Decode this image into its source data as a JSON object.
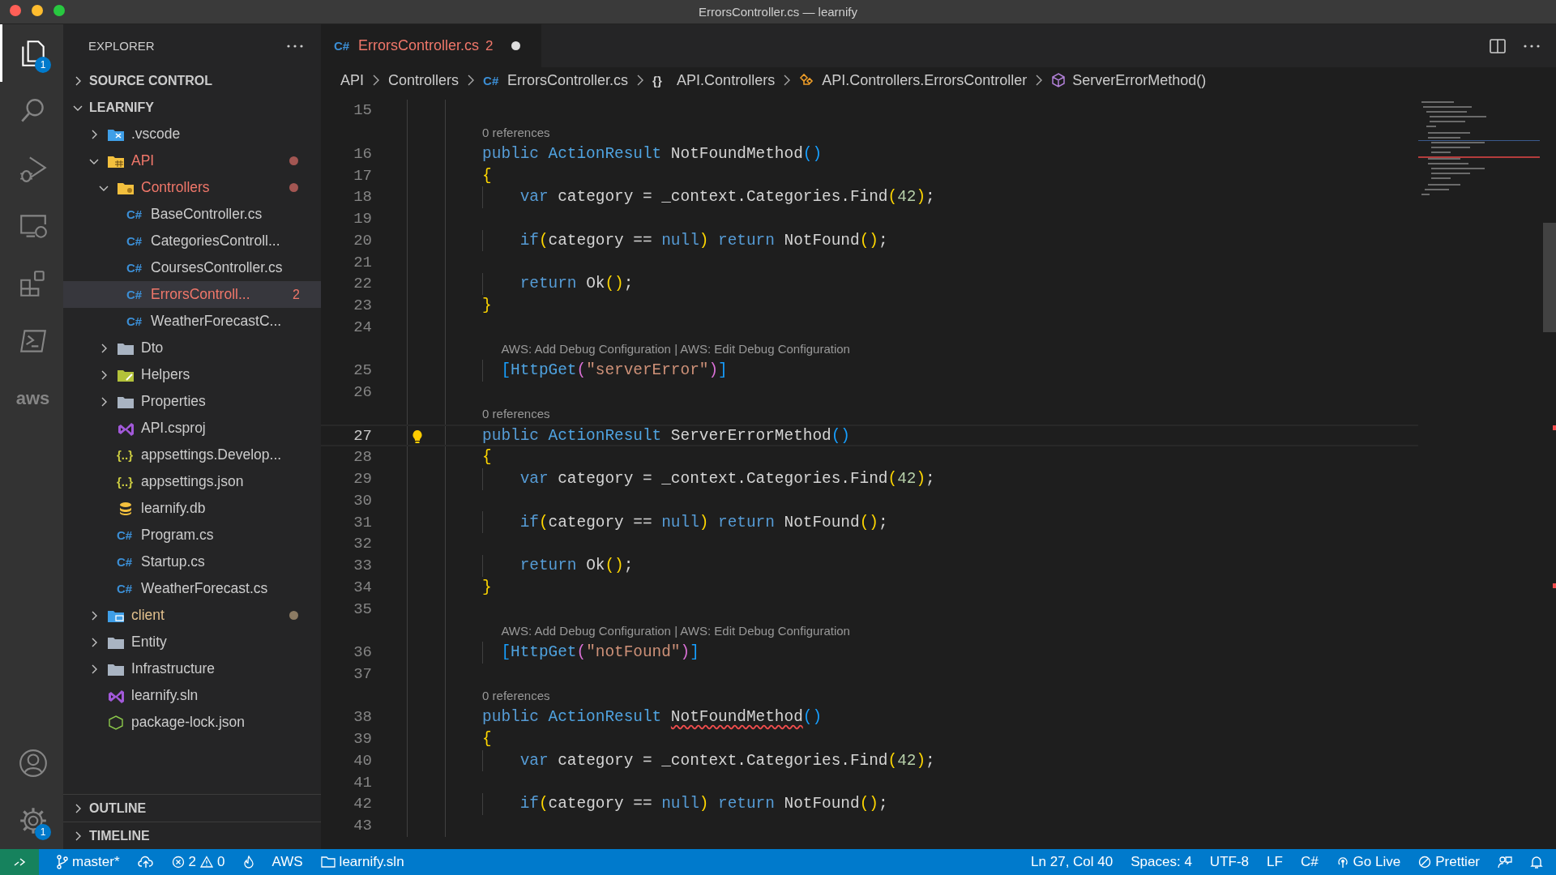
{
  "window": {
    "title": "ErrorsController.cs — learnify"
  },
  "activity_bar": {
    "top": [
      {
        "kind": "explorer",
        "selected": true,
        "badge": "1"
      },
      {
        "kind": "search",
        "selected": false
      },
      {
        "kind": "debug",
        "selected": false
      },
      {
        "kind": "remote",
        "selected": false
      },
      {
        "kind": "extensions",
        "selected": false
      },
      {
        "kind": "terminal",
        "selected": false
      },
      {
        "kind": "aws",
        "selected": false,
        "glyph": "aws"
      }
    ],
    "bottom": [
      {
        "kind": "account",
        "selected": false
      },
      {
        "kind": "settings",
        "selected": false,
        "badge": "1"
      }
    ]
  },
  "explorer": {
    "title": "EXPLORER",
    "sections": [
      {
        "label": "SOURCE CONTROL",
        "expanded": false
      },
      {
        "label": "LEARNIFY",
        "expanded": true,
        "tree": [
          {
            "label": ".vscode",
            "kind": "folder-vscode",
            "expanded": false,
            "has_errors": false,
            "modified": false,
            "selected": false
          },
          {
            "label": "API",
            "kind": "folder-api",
            "expanded": true,
            "has_errors": true,
            "modified": false,
            "selected": false,
            "children": [
              {
                "label": "Controllers",
                "kind": "folder-controllers",
                "expanded": true,
                "has_errors": true,
                "modified": false,
                "selected": false,
                "children": [
                  {
                    "label": "BaseController.cs",
                    "kind": "csharp",
                    "glyph": "C#",
                    "has_errors": false,
                    "modified": false,
                    "selected": false
                  },
                  {
                    "label": "CategoriesControll...",
                    "kind": "csharp",
                    "glyph": "C#",
                    "has_errors": false,
                    "modified": false,
                    "selected": false
                  },
                  {
                    "label": "CoursesController.cs",
                    "kind": "csharp",
                    "glyph": "C#",
                    "has_errors": false,
                    "modified": false,
                    "selected": false
                  },
                  {
                    "label": "ErrorsControll...",
                    "kind": "csharp",
                    "glyph": "C#",
                    "has_errors": true,
                    "modified": false,
                    "badge": "2",
                    "selected": true
                  },
                  {
                    "label": "WeatherForecastC...",
                    "kind": "csharp",
                    "glyph": "C#",
                    "has_errors": false,
                    "modified": false,
                    "selected": false
                  }
                ]
              },
              {
                "label": "Dto",
                "kind": "folder",
                "expanded": false,
                "has_errors": false,
                "modified": false,
                "selected": false
              },
              {
                "label": "Helpers",
                "kind": "folder-helpers",
                "expanded": false,
                "has_errors": false,
                "modified": false,
                "selected": false
              },
              {
                "label": "Properties",
                "kind": "folder",
                "expanded": false,
                "has_errors": false,
                "modified": false,
                "selected": false
              },
              {
                "label": "API.csproj",
                "kind": "vs",
                "has_errors": false,
                "modified": false,
                "selected": false
              },
              {
                "label": "appsettings.Develop...",
                "kind": "json",
                "glyph": "{..}",
                "has_errors": false,
                "modified": false,
                "selected": false
              },
              {
                "label": "appsettings.json",
                "kind": "json",
                "glyph": "{..}",
                "has_errors": false,
                "modified": false,
                "selected": false
              },
              {
                "label": "learnify.db",
                "kind": "db",
                "has_errors": false,
                "modified": false,
                "selected": false
              },
              {
                "label": "Program.cs",
                "kind": "csharp",
                "glyph": "C#",
                "has_errors": false,
                "modified": false,
                "selected": false
              },
              {
                "label": "Startup.cs",
                "kind": "csharp",
                "glyph": "C#",
                "has_errors": false,
                "modified": false,
                "selected": false
              },
              {
                "label": "WeatherForecast.cs",
                "kind": "csharp",
                "glyph": "C#",
                "has_errors": false,
                "modified": false,
                "selected": false
              }
            ]
          },
          {
            "label": "client",
            "kind": "folder-client",
            "expanded": false,
            "has_errors": false,
            "modified": true,
            "selected": false
          },
          {
            "label": "Entity",
            "kind": "folder",
            "expanded": false,
            "has_errors": false,
            "modified": false,
            "selected": false
          },
          {
            "label": "Infrastructure",
            "kind": "folder",
            "expanded": false,
            "has_errors": false,
            "modified": false,
            "selected": false
          },
          {
            "label": "learnify.sln",
            "kind": "vs",
            "has_errors": false,
            "modified": false,
            "selected": false
          },
          {
            "label": "package-lock.json",
            "kind": "node",
            "has_errors": false,
            "modified": false,
            "selected": false
          }
        ]
      },
      {
        "label": "OUTLINE",
        "expanded": false
      },
      {
        "label": "TIMELINE",
        "expanded": false
      }
    ]
  },
  "tabs": [
    {
      "label": "ErrorsController.cs",
      "kind": "csharp",
      "glyph": "C#",
      "problems": "2",
      "dirty": true,
      "selected": true
    }
  ],
  "breadcrumbs": [
    {
      "label": "API"
    },
    {
      "label": "Controllers"
    },
    {
      "label": "ErrorsController.cs",
      "kind": "csharp",
      "glyph": "C#"
    },
    {
      "label": "API.Controllers",
      "kind": "namespace",
      "glyph": "{}"
    },
    {
      "label": "API.Controllers.ErrorsController",
      "kind": "class"
    },
    {
      "label": "ServerErrorMethod()",
      "kind": "method"
    }
  ],
  "editor": {
    "lines": [
      {
        "kind": "code",
        "number": "15",
        "active": false
      },
      {
        "kind": "lens",
        "text": "0 references"
      },
      {
        "kind": "code",
        "number": "16",
        "active": false,
        "tokens": [
          {
            "text": "        public ",
            "kind": "kw"
          },
          {
            "text": "ActionResult ",
            "kind": "type"
          },
          {
            "text": "NotFoundMethod",
            "kind": "plain"
          },
          {
            "text": "()",
            "kind": "b3"
          }
        ]
      },
      {
        "kind": "code",
        "number": "17",
        "active": false,
        "tokens": [
          {
            "text": "        {",
            "kind": "b1"
          }
        ]
      },
      {
        "kind": "code",
        "number": "18",
        "active": false,
        "tokens": [
          {
            "text": "            var ",
            "kind": "kw"
          },
          {
            "text": "category = _context.Categories.Find",
            "kind": "plain"
          },
          {
            "text": "(",
            "kind": "b1"
          },
          {
            "text": "42",
            "kind": "num"
          },
          {
            "text": ")",
            "kind": "b1"
          },
          {
            "text": ";",
            "kind": "plain"
          }
        ]
      },
      {
        "kind": "code",
        "number": "19",
        "active": false
      },
      {
        "kind": "code",
        "number": "20",
        "active": false,
        "tokens": [
          {
            "text": "            if",
            "kind": "kw"
          },
          {
            "text": "(",
            "kind": "b1"
          },
          {
            "text": "category == ",
            "kind": "plain"
          },
          {
            "text": "null",
            "kind": "kw"
          },
          {
            "text": ") ",
            "kind": "b1"
          },
          {
            "text": "return ",
            "kind": "kw"
          },
          {
            "text": "NotFound",
            "kind": "plain"
          },
          {
            "text": "()",
            "kind": "b1"
          },
          {
            "text": ";",
            "kind": "plain"
          }
        ]
      },
      {
        "kind": "code",
        "number": "21",
        "active": false
      },
      {
        "kind": "code",
        "number": "22",
        "active": false,
        "tokens": [
          {
            "text": "            return ",
            "kind": "kw"
          },
          {
            "text": "Ok",
            "kind": "plain"
          },
          {
            "text": "()",
            "kind": "b1"
          },
          {
            "text": ";",
            "kind": "plain"
          }
        ]
      },
      {
        "kind": "code",
        "number": "23",
        "active": false,
        "tokens": [
          {
            "text": "        }",
            "kind": "b1"
          }
        ]
      },
      {
        "kind": "code",
        "number": "24",
        "active": false
      },
      {
        "kind": "lens",
        "text": "AWS: Add Debug Configuration | AWS: Edit Debug Configuration"
      },
      {
        "kind": "code",
        "number": "25",
        "active": false,
        "tokens": [
          {
            "text": "          [",
            "kind": "b3"
          },
          {
            "text": "HttpGet",
            "kind": "type"
          },
          {
            "text": "(",
            "kind": "b2"
          },
          {
            "text": "\"serverError\"",
            "kind": "str"
          },
          {
            "text": ")",
            "kind": "b2"
          },
          {
            "text": "]",
            "kind": "b3"
          }
        ]
      },
      {
        "kind": "code",
        "number": "26",
        "active": false
      },
      {
        "kind": "lens",
        "text": "0 references"
      },
      {
        "kind": "code",
        "number": "27",
        "active": true,
        "tokens": [
          {
            "text": "        public ",
            "kind": "kw"
          },
          {
            "text": "ActionResult ",
            "kind": "type"
          },
          {
            "text": "ServerErrorMethod",
            "kind": "plain"
          },
          {
            "text": "()",
            "kind": "b3"
          }
        ]
      },
      {
        "kind": "code",
        "number": "28",
        "active": false,
        "tokens": [
          {
            "text": "        {",
            "kind": "b1"
          }
        ]
      },
      {
        "kind": "code",
        "number": "29",
        "active": false,
        "tokens": [
          {
            "text": "            var ",
            "kind": "kw"
          },
          {
            "text": "category = _context.Categories.Find",
            "kind": "plain"
          },
          {
            "text": "(",
            "kind": "b1"
          },
          {
            "text": "42",
            "kind": "num"
          },
          {
            "text": ")",
            "kind": "b1"
          },
          {
            "text": ";",
            "kind": "plain"
          }
        ]
      },
      {
        "kind": "code",
        "number": "30",
        "active": false
      },
      {
        "kind": "code",
        "number": "31",
        "active": false,
        "tokens": [
          {
            "text": "            if",
            "kind": "kw"
          },
          {
            "text": "(",
            "kind": "b1"
          },
          {
            "text": "category == ",
            "kind": "plain"
          },
          {
            "text": "null",
            "kind": "kw"
          },
          {
            "text": ") ",
            "kind": "b1"
          },
          {
            "text": "return ",
            "kind": "kw"
          },
          {
            "text": "NotFound",
            "kind": "plain"
          },
          {
            "text": "()",
            "kind": "b1"
          },
          {
            "text": ";",
            "kind": "plain"
          }
        ]
      },
      {
        "kind": "code",
        "number": "32",
        "active": false
      },
      {
        "kind": "code",
        "number": "33",
        "active": false,
        "tokens": [
          {
            "text": "            return ",
            "kind": "kw"
          },
          {
            "text": "Ok",
            "kind": "plain"
          },
          {
            "text": "()",
            "kind": "b1"
          },
          {
            "text": ";",
            "kind": "plain"
          }
        ]
      },
      {
        "kind": "code",
        "number": "34",
        "active": false,
        "tokens": [
          {
            "text": "        }",
            "kind": "b1"
          }
        ]
      },
      {
        "kind": "code",
        "number": "35",
        "active": false
      },
      {
        "kind": "lens",
        "text": "AWS: Add Debug Configuration | AWS: Edit Debug Configuration"
      },
      {
        "kind": "code",
        "number": "36",
        "active": false,
        "tokens": [
          {
            "text": "          [",
            "kind": "b3"
          },
          {
            "text": "HttpGet",
            "kind": "type"
          },
          {
            "text": "(",
            "kind": "b2"
          },
          {
            "text": "\"notFound\"",
            "kind": "str"
          },
          {
            "text": ")",
            "kind": "b2"
          },
          {
            "text": "]",
            "kind": "b3"
          }
        ]
      },
      {
        "kind": "code",
        "number": "37",
        "active": false
      },
      {
        "kind": "lens",
        "text": "0 references"
      },
      {
        "kind": "code",
        "number": "38",
        "active": false,
        "tokens": [
          {
            "text": "        public ",
            "kind": "kw"
          },
          {
            "text": "ActionResult ",
            "kind": "type"
          },
          {
            "text": "NotFoundMethod",
            "kind": "error"
          },
          {
            "text": "()",
            "kind": "b3"
          }
        ]
      },
      {
        "kind": "code",
        "number": "39",
        "active": false,
        "tokens": [
          {
            "text": "        {",
            "kind": "b1"
          }
        ]
      },
      {
        "kind": "code",
        "number": "40",
        "active": false,
        "tokens": [
          {
            "text": "            var ",
            "kind": "kw"
          },
          {
            "text": "category = _context.Categories.Find",
            "kind": "plain"
          },
          {
            "text": "(",
            "kind": "b1"
          },
          {
            "text": "42",
            "kind": "num"
          },
          {
            "text": ")",
            "kind": "b1"
          },
          {
            "text": ";",
            "kind": "plain"
          }
        ]
      },
      {
        "kind": "code",
        "number": "41",
        "active": false
      },
      {
        "kind": "code",
        "number": "42",
        "active": false,
        "tokens": [
          {
            "text": "            if",
            "kind": "kw"
          },
          {
            "text": "(",
            "kind": "b1"
          },
          {
            "text": "category == ",
            "kind": "plain"
          },
          {
            "text": "null",
            "kind": "kw"
          },
          {
            "text": ") ",
            "kind": "b1"
          },
          {
            "text": "return ",
            "kind": "kw"
          },
          {
            "text": "NotFound",
            "kind": "plain"
          },
          {
            "text": "()",
            "kind": "b1"
          },
          {
            "text": ";",
            "kind": "plain"
          }
        ]
      },
      {
        "kind": "code",
        "number": "43",
        "active": false
      }
    ]
  },
  "status_bar": {
    "left": [
      {
        "kind": "remote"
      },
      {
        "kind": "branch",
        "label": "master*"
      },
      {
        "kind": "sync"
      },
      {
        "kind": "problems",
        "errors": "2",
        "warnings": "0"
      },
      {
        "kind": "flame"
      },
      {
        "kind": "text",
        "label": "AWS"
      },
      {
        "kind": "folder",
        "label": "learnify.sln"
      }
    ],
    "right": [
      {
        "kind": "text",
        "label": "Ln 27, Col 40"
      },
      {
        "kind": "text",
        "label": "Spaces: 4"
      },
      {
        "kind": "text",
        "label": "UTF-8"
      },
      {
        "kind": "text",
        "label": "LF"
      },
      {
        "kind": "text",
        "label": "C#"
      },
      {
        "kind": "golive",
        "label": "Go Live"
      },
      {
        "kind": "prettier",
        "label": "Prettier"
      },
      {
        "kind": "feedback"
      },
      {
        "kind": "bell"
      }
    ]
  }
}
